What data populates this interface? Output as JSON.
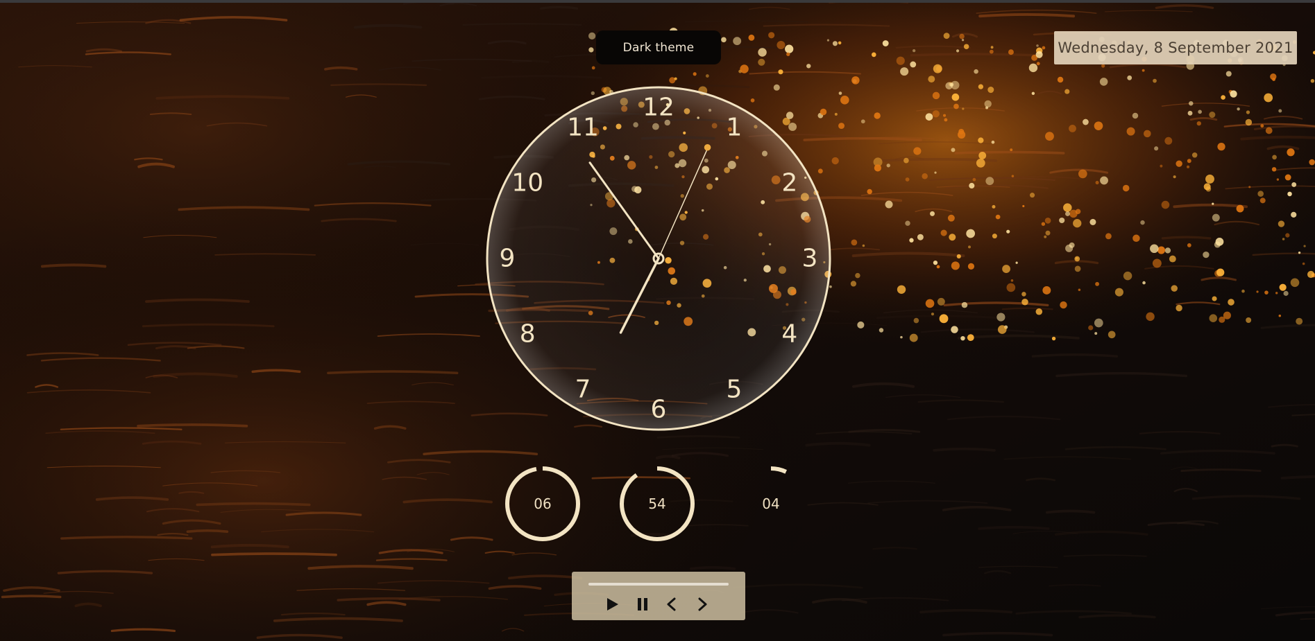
{
  "theme_toggle": {
    "label": "Dark theme"
  },
  "date_display": {
    "text": "Wednesday, 8  September  2021"
  },
  "clock": {
    "numerals": [
      "12",
      "1",
      "2",
      "3",
      "4",
      "5",
      "6",
      "7",
      "8",
      "9",
      "10",
      "11"
    ],
    "time": {
      "hour": 6,
      "minute": 54,
      "second": 4
    }
  },
  "counters": [
    {
      "name": "hours",
      "label": "06",
      "progress": 0.97
    },
    {
      "name": "minutes",
      "label": "54",
      "progress": 0.9
    },
    {
      "name": "seconds",
      "label": "04",
      "progress": 0.07
    }
  ],
  "player": {
    "progress": 0,
    "controls": [
      {
        "name": "play",
        "icon": "play-icon"
      },
      {
        "name": "pause",
        "icon": "pause-icon"
      },
      {
        "name": "previous",
        "icon": "chevron-left-icon"
      },
      {
        "name": "next",
        "icon": "chevron-right-icon"
      }
    ]
  },
  "colors": {
    "accent": "#f3e4c3",
    "theme_button_bg": "#080605",
    "date_bg": "#e2d2b9",
    "player_bg": "#cdbea0"
  }
}
